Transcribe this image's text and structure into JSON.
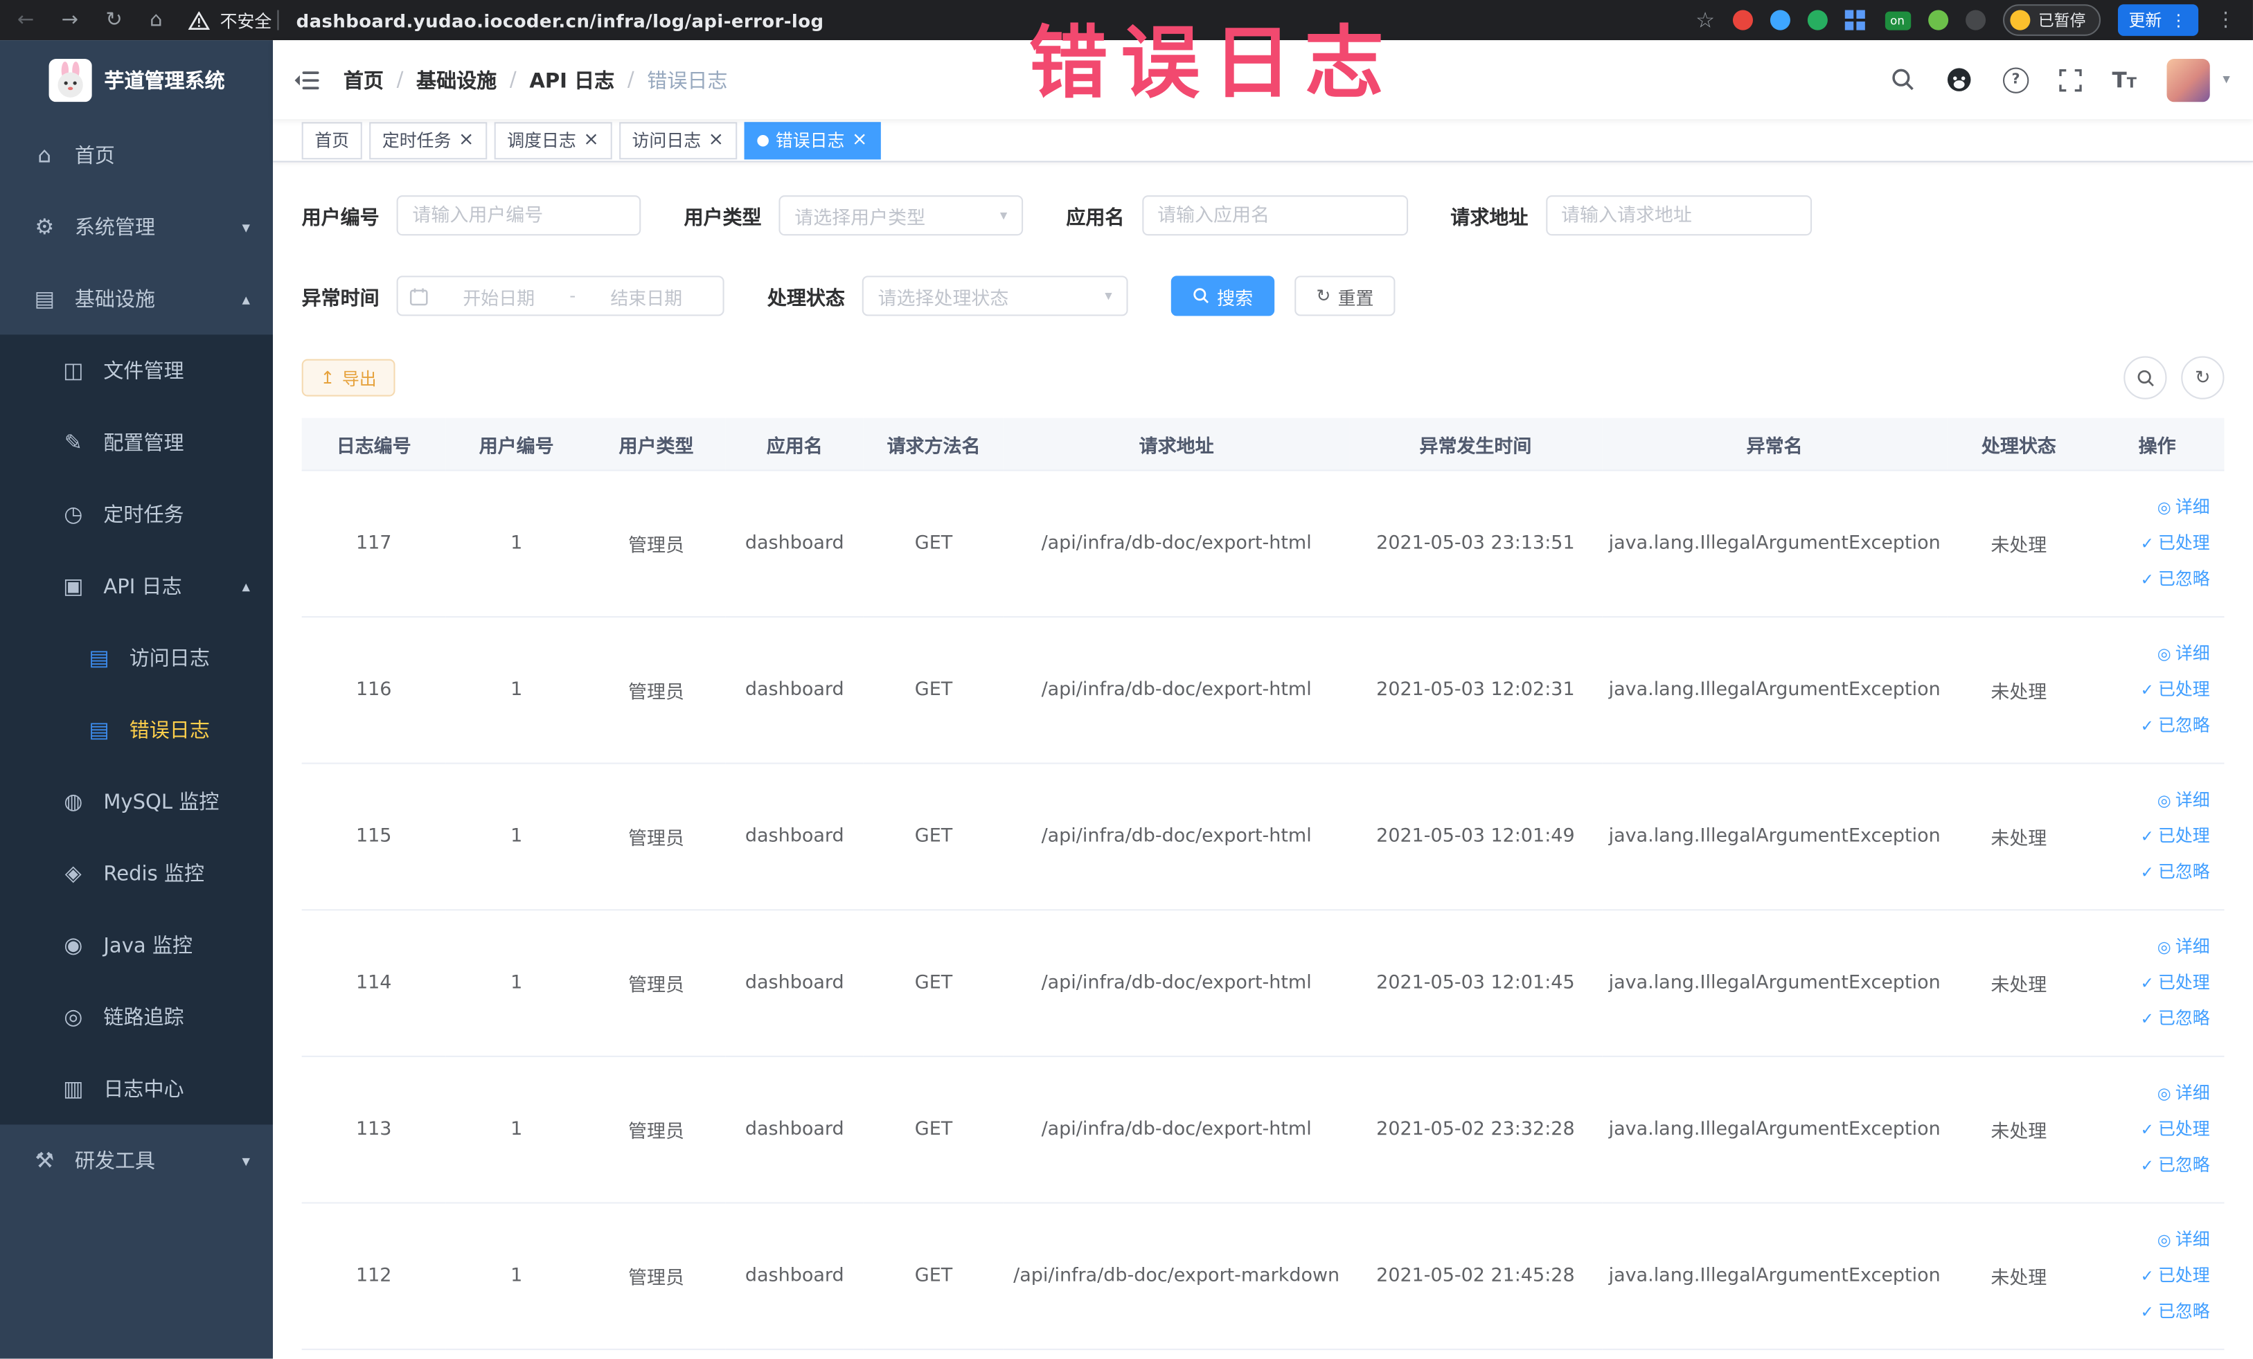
{
  "browser": {
    "security_text": "不安全",
    "url": "dashboard.yudao.iocoder.cn/infra/log/api-error-log",
    "ext_on_badge": "on",
    "paused_badge": "已暂停",
    "update_button": "更新"
  },
  "annotation": "错误日志",
  "sidebar": {
    "logo_title": "芋道管理系统",
    "items": [
      {
        "label": "首页"
      },
      {
        "label": "系统管理"
      },
      {
        "label": "基础设施"
      },
      {
        "label": "文件管理"
      },
      {
        "label": "配置管理"
      },
      {
        "label": "定时任务"
      },
      {
        "label": "API 日志"
      },
      {
        "label": "访问日志"
      },
      {
        "label": "错误日志"
      },
      {
        "label": "MySQL 监控"
      },
      {
        "label": "Redis 监控"
      },
      {
        "label": "Java 监控"
      },
      {
        "label": "链路追踪"
      },
      {
        "label": "日志中心"
      },
      {
        "label": "研发工具"
      }
    ]
  },
  "breadcrumb": {
    "separator": "/",
    "items": [
      "首页",
      "基础设施",
      "API 日志",
      "错误日志"
    ]
  },
  "tabs": [
    {
      "label": "首页"
    },
    {
      "label": "定时任务"
    },
    {
      "label": "调度日志"
    },
    {
      "label": "访问日志"
    },
    {
      "label": "错误日志"
    }
  ],
  "filters": {
    "user_id": {
      "label": "用户编号",
      "placeholder": "请输入用户编号"
    },
    "user_type": {
      "label": "用户类型",
      "placeholder": "请选择用户类型"
    },
    "app_name": {
      "label": "应用名",
      "placeholder": "请输入应用名"
    },
    "request_url": {
      "label": "请求地址",
      "placeholder": "请输入请求地址"
    },
    "exception_time": {
      "label": "异常时间",
      "start_placeholder": "开始日期",
      "separator": "-",
      "end_placeholder": "结束日期"
    },
    "process_status": {
      "label": "处理状态",
      "placeholder": "请选择处理状态"
    },
    "search_button": "搜索",
    "reset_button": "重置"
  },
  "toolbar": {
    "export_button": "导出"
  },
  "table": {
    "headers": [
      "日志编号",
      "用户编号",
      "用户类型",
      "应用名",
      "请求方法名",
      "请求地址",
      "异常发生时间",
      "异常名",
      "处理状态",
      "操作"
    ],
    "action_labels": {
      "detail": "详细",
      "processed": "已处理",
      "ignored": "已忽略"
    },
    "rows": [
      {
        "id": "117",
        "user_id": "1",
        "user_type": "管理员",
        "app": "dashboard",
        "method": "GET",
        "url": "/api/infra/db-doc/export-html",
        "time": "2021-05-03 23:13:51",
        "exception": "java.lang.IllegalArgumentException",
        "status": "未处理"
      },
      {
        "id": "116",
        "user_id": "1",
        "user_type": "管理员",
        "app": "dashboard",
        "method": "GET",
        "url": "/api/infra/db-doc/export-html",
        "time": "2021-05-03 12:02:31",
        "exception": "java.lang.IllegalArgumentException",
        "status": "未处理"
      },
      {
        "id": "115",
        "user_id": "1",
        "user_type": "管理员",
        "app": "dashboard",
        "method": "GET",
        "url": "/api/infra/db-doc/export-html",
        "time": "2021-05-03 12:01:49",
        "exception": "java.lang.IllegalArgumentException",
        "status": "未处理"
      },
      {
        "id": "114",
        "user_id": "1",
        "user_type": "管理员",
        "app": "dashboard",
        "method": "GET",
        "url": "/api/infra/db-doc/export-html",
        "time": "2021-05-03 12:01:45",
        "exception": "java.lang.IllegalArgumentException",
        "status": "未处理"
      },
      {
        "id": "113",
        "user_id": "1",
        "user_type": "管理员",
        "app": "dashboard",
        "method": "GET",
        "url": "/api/infra/db-doc/export-html",
        "time": "2021-05-02 23:32:28",
        "exception": "java.lang.IllegalArgumentException",
        "status": "未处理"
      },
      {
        "id": "112",
        "user_id": "1",
        "user_type": "管理员",
        "app": "dashboard",
        "method": "GET",
        "url": "/api/infra/db-doc/export-markdown",
        "time": "2021-05-02 21:45:28",
        "exception": "java.lang.IllegalArgumentException",
        "status": "未处理"
      }
    ]
  }
}
